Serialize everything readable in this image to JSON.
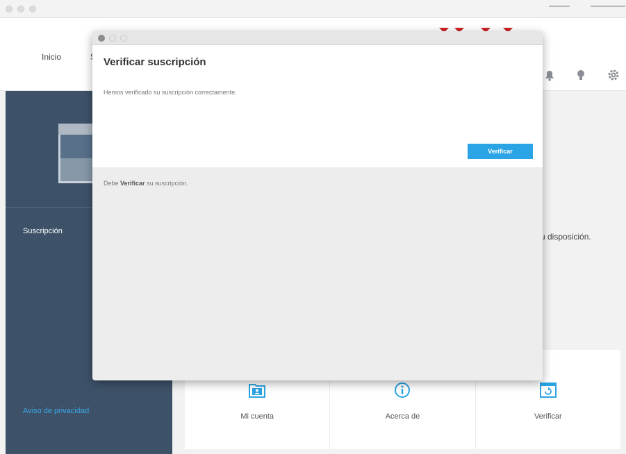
{
  "header": {
    "nav_inicio": "Inicio",
    "nav_partial": "S"
  },
  "sidebar": {
    "suscripcion": "Suscripción",
    "privacidad": "Aviso de privacidad"
  },
  "main": {
    "disposicion_text": "u disposición.",
    "cards": [
      {
        "label": "Mi cuenta",
        "icon": "folder-user-icon"
      },
      {
        "label": "Acerca de",
        "icon": "info-icon"
      },
      {
        "label": "Verificar",
        "icon": "refresh-window-icon"
      }
    ]
  },
  "dialog": {
    "title": "Verificar suscripción",
    "message": "Hemos verificado su suscripción correctamente.",
    "verify_button": "Verificar",
    "note_prefix": "Debe ",
    "note_bold": "Verificar",
    "note_suffix": " su suscripción."
  },
  "colors": {
    "sidebar": "#3d5269",
    "accent": "#2aa4e4",
    "brand": "#cc2222"
  }
}
